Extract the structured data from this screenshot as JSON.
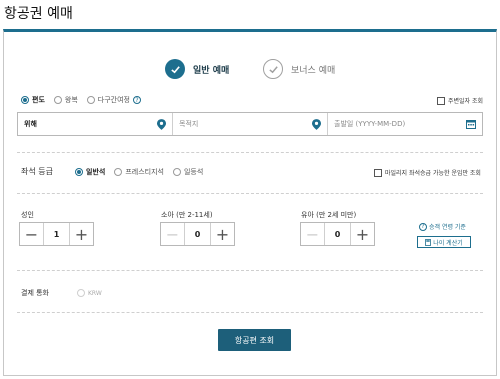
{
  "page": {
    "title": "항공권 예매"
  },
  "booking_modes": [
    {
      "label": "일반 예매",
      "active": true
    },
    {
      "label": "보너스 예매",
      "active": false
    }
  ],
  "trip_types": [
    {
      "label": "편도",
      "selected": true
    },
    {
      "label": "왕복",
      "selected": false
    },
    {
      "label": "다구간여정",
      "selected": false
    }
  ],
  "nearby_dates": {
    "label": "주변일자 조회",
    "checked": false
  },
  "route": {
    "origin": {
      "value": "위해",
      "icon": "map-pin-icon"
    },
    "destination": {
      "placeholder": "목적지",
      "icon": "map-pin-icon"
    },
    "date": {
      "placeholder": "출발일 (YYYY-MM-DD)",
      "icon": "calendar-icon"
    }
  },
  "cabin": {
    "label": "좌석 등급",
    "options": [
      {
        "label": "일반석",
        "selected": true
      },
      {
        "label": "프레스티지석",
        "selected": false
      },
      {
        "label": "일등석",
        "selected": false
      }
    ],
    "upgrade_check": {
      "label": "마일리지 좌석승급 가능한 운임만 조회",
      "checked": false
    }
  },
  "passengers": {
    "adult": {
      "label": "성인",
      "count": "1"
    },
    "child": {
      "label": "소아 (만 2-11세)",
      "count": "0"
    },
    "infant": {
      "label": "유아 (만 2세 미만)",
      "count": "0"
    },
    "help_link": "승객 연령 기준",
    "age_calc": "나이 계산기"
  },
  "currency": {
    "label": "결제 통화",
    "option": "KRW"
  },
  "search_button": "항공편 조회",
  "colors": {
    "accent": "#1d6e8e",
    "button": "#1d5f7a",
    "border": "#b8b8b8"
  }
}
